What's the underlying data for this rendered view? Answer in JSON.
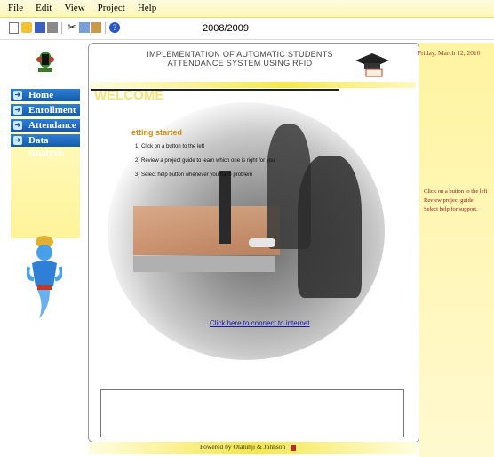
{
  "menu": [
    "File",
    "Edit",
    "View",
    "Project",
    "Help"
  ],
  "toolbar": {
    "icons": [
      "new-file-icon",
      "open-folder-icon",
      "save-icon",
      "print-icon",
      "cut-icon",
      "copy-icon",
      "paste-icon",
      "help-icon"
    ],
    "year": "2008/2009"
  },
  "sidebar": {
    "items": [
      {
        "label": "Home"
      },
      {
        "label": "Enrollment"
      },
      {
        "label": "Attendance"
      },
      {
        "label": "Data Analysis"
      }
    ]
  },
  "header": {
    "title_line1": "IMPLEMENTATION OF AUTOMATIC STUDENTS",
    "title_line2": "ATTENDANCE SYSTEM USING RFID"
  },
  "main": {
    "welcome": "WELCOME",
    "getting_started": "etting started",
    "steps": [
      "1) Click on a button to the left",
      "2) Review a project guide to learn which one is right for you",
      "3) Select help button whenever you have problem"
    ],
    "connect_link": "Click here to connect to internet"
  },
  "footer": {
    "text": "Powered by Olatunji & Johnson"
  },
  "right": {
    "date": "Friday, March 12, 2010",
    "tips": [
      "Click on a button to the left",
      "Review project guide",
      "Select help for support."
    ]
  }
}
